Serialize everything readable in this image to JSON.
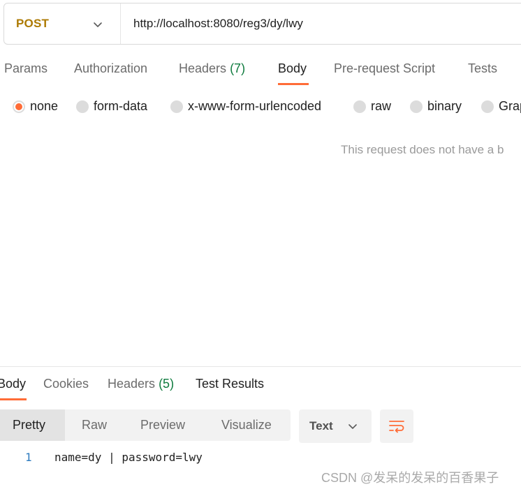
{
  "request": {
    "method": "POST",
    "url": "http://localhost:8080/reg3/dy/lwy"
  },
  "request_tabs": {
    "params": "Params",
    "authorization": "Authorization",
    "headers": "Headers",
    "headers_count": "(7)",
    "body": "Body",
    "prerequest": "Pre-request Script",
    "tests": "Tests",
    "active": "Body"
  },
  "body_types": {
    "none": "none",
    "form_data": "form-data",
    "urlencoded": "x-www-form-urlencoded",
    "raw": "raw",
    "binary": "binary",
    "graphql": "Grap",
    "selected": "none"
  },
  "empty_message": "This request does not have a b",
  "response_tabs": {
    "body": "Body",
    "cookies": "Cookies",
    "headers": "Headers",
    "headers_count": "(5)",
    "test_results": "Test Results",
    "active": "Body"
  },
  "format": {
    "pretty": "Pretty",
    "raw": "Raw",
    "preview": "Preview",
    "visualize": "Visualize",
    "active": "Pretty"
  },
  "language": "Text",
  "response_body": {
    "line_number": "1",
    "content": "name=dy | password=lwy"
  },
  "watermark": "CSDN @发呆的发呆的百香果子",
  "colors": {
    "accent": "#ff6c37",
    "method": "#ad7a03",
    "count": "#0f7b3e",
    "line_number": "#2d7bbf"
  }
}
